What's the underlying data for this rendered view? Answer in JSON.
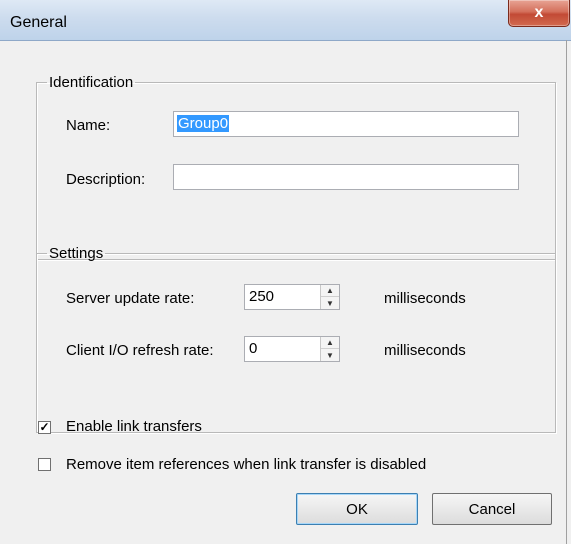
{
  "window": {
    "title": "General",
    "close_label": "x"
  },
  "identification": {
    "legend": "Identification",
    "name_label": "Name:",
    "name_value": "Group0",
    "description_label": "Description:",
    "description_value": ""
  },
  "settings": {
    "legend": "Settings",
    "server_rate_label": "Server update rate:",
    "server_rate_value": "250",
    "server_rate_unit": "milliseconds",
    "client_rate_label": "Client I/O refresh rate:",
    "client_rate_value": "0",
    "client_rate_unit": "milliseconds"
  },
  "options": {
    "enable_link_label": "Enable link transfers",
    "enable_link_checked": true,
    "remove_refs_label": "Remove item references when link transfer is disabled",
    "remove_refs_checked": false
  },
  "buttons": {
    "ok": "OK",
    "cancel": "Cancel"
  }
}
